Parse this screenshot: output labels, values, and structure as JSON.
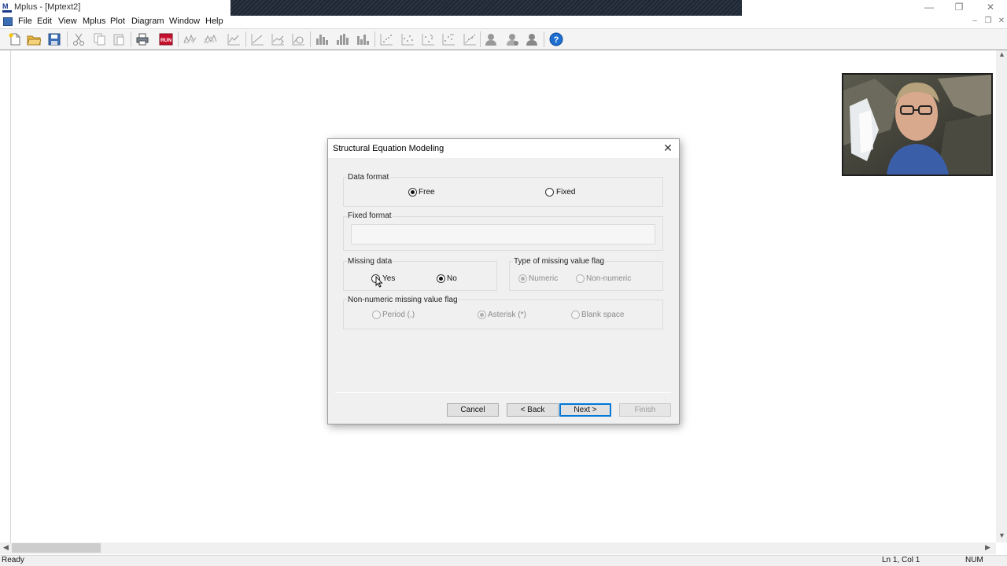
{
  "window": {
    "title": "Mplus - [Mptext2]",
    "logo_text": "M\nplus",
    "minimize_icon": "minimize-icon",
    "restore_icon": "restore-icon",
    "close_icon": "close-icon"
  },
  "menu": {
    "items": [
      "File",
      "Edit",
      "View",
      "Mplus",
      "Plot",
      "Diagram",
      "Window",
      "Help"
    ]
  },
  "toolbar": {
    "buttons": [
      "new-file-icon",
      "open-folder-icon",
      "save-icon",
      "cut-icon",
      "copy-icon",
      "paste-icon",
      "print-icon",
      "run-icon",
      "plot-icon-1",
      "plot-icon-2",
      "plot-icon-3",
      "plot-icon-4",
      "plot-icon-5",
      "plot-icon-6",
      "bar-chart-icon-1",
      "bar-chart-icon-2",
      "bar-chart-icon-3",
      "scatter-icon-1",
      "scatter-icon-2",
      "scatter-icon-3",
      "scatter-icon-4",
      "scatter-icon-5",
      "person-icon-1",
      "person-icon-2",
      "person-icon-3",
      "help-icon"
    ],
    "run_label": "RUN",
    "help_label": "?"
  },
  "dialog": {
    "title": "Structural Equation Modeling",
    "data_format": {
      "label": "Data format",
      "options": [
        {
          "label": "Free",
          "checked": true,
          "enabled": true
        },
        {
          "label": "Fixed",
          "checked": false,
          "enabled": true
        }
      ]
    },
    "fixed_format": {
      "label": "Fixed format",
      "value": ""
    },
    "missing_data": {
      "label": "Missing data",
      "options": [
        {
          "label": "Yes",
          "checked": false,
          "enabled": true
        },
        {
          "label": "No",
          "checked": true,
          "enabled": true
        }
      ]
    },
    "missing_flag_type": {
      "label": "Type of missing value flag",
      "options": [
        {
          "label": "Numeric",
          "checked": true,
          "enabled": false
        },
        {
          "label": "Non-numeric",
          "checked": false,
          "enabled": false
        }
      ]
    },
    "non_numeric_flag": {
      "label": "Non-numeric missing value flag",
      "options": [
        {
          "label": "Period (.)",
          "checked": false,
          "enabled": false
        },
        {
          "label": "Asterisk (*)",
          "checked": true,
          "enabled": false
        },
        {
          "label": "Blank space",
          "checked": false,
          "enabled": false
        }
      ]
    },
    "buttons": {
      "cancel": "Cancel",
      "back": "< Back",
      "next": "Next >",
      "finish": "Finish"
    }
  },
  "status": {
    "left": "Ready",
    "position": "Ln 1, Col 1",
    "numlock": "NUM"
  },
  "colors": {
    "accent": "#0078d7",
    "dialog_bg": "#f0f0f0",
    "toolbar_bg": "#f4f4f4"
  }
}
